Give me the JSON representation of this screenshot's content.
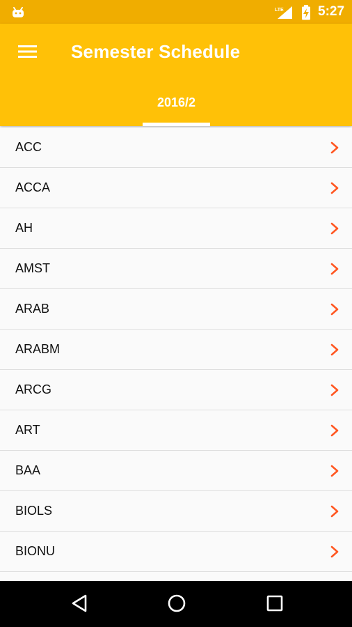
{
  "status_bar": {
    "time": "5:27",
    "network": "LTE"
  },
  "app_bar": {
    "title": "Semester Schedule"
  },
  "tabs": [
    {
      "label": "2016/2",
      "selected": true
    }
  ],
  "list": {
    "items": [
      {
        "label": "ACC"
      },
      {
        "label": "ACCA"
      },
      {
        "label": "AH"
      },
      {
        "label": "AMST"
      },
      {
        "label": "ARAB"
      },
      {
        "label": "ARABM"
      },
      {
        "label": "ARCG"
      },
      {
        "label": "ART"
      },
      {
        "label": "BAA"
      },
      {
        "label": "BIOLS"
      },
      {
        "label": "BIONU"
      },
      {
        "label": ""
      }
    ]
  },
  "colors": {
    "primary": "#ffc107",
    "status_bar": "#f0ad00",
    "chevron": "#ff5722",
    "nav_bar": "#000000"
  }
}
